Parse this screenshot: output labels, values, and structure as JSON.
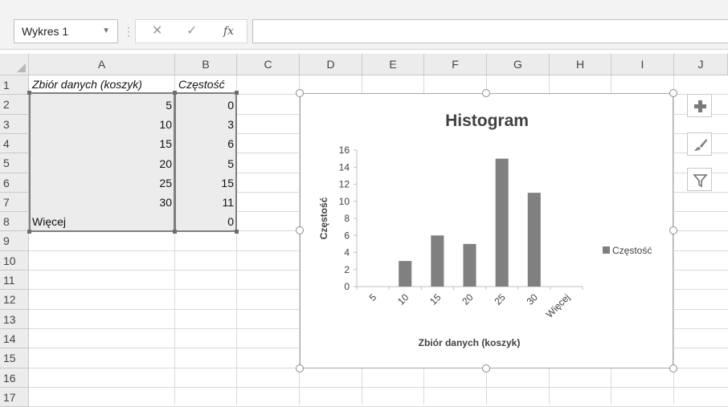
{
  "formula_bar": {
    "name_box": "Wykres 1",
    "dropdown_glyph": "▼",
    "separator_glyph": "⋮",
    "cancel_glyph": "✕",
    "confirm_glyph": "✓",
    "function_glyph": "fx",
    "formula_value": ""
  },
  "grid": {
    "columns": [
      "A",
      "B",
      "C",
      "D",
      "E",
      "F",
      "G",
      "H",
      "I",
      "J"
    ],
    "rows": [
      "1",
      "2",
      "3",
      "4",
      "5",
      "6",
      "7",
      "8",
      "9",
      "10",
      "11",
      "12",
      "13",
      "14",
      "15",
      "16",
      "17"
    ],
    "header": {
      "a": "Zbiór danych (koszyk)",
      "b": "Częstość"
    },
    "data_rows": [
      {
        "a": "5",
        "b": "0"
      },
      {
        "a": "10",
        "b": "3"
      },
      {
        "a": "15",
        "b": "6"
      },
      {
        "a": "20",
        "b": "5"
      },
      {
        "a": "25",
        "b": "15"
      },
      {
        "a": "30",
        "b": "11"
      },
      {
        "a": "Więcej",
        "b": "0"
      }
    ]
  },
  "chart_data": {
    "type": "bar",
    "title": "Histogram",
    "xlabel": "Zbiór danych (koszyk)",
    "ylabel": "Częstość",
    "categories": [
      "5",
      "10",
      "15",
      "20",
      "25",
      "30",
      "Więcej"
    ],
    "series": [
      {
        "name": "Częstość",
        "values": [
          0,
          3,
          6,
          5,
          15,
          11,
          0
        ],
        "color": "#808080"
      }
    ],
    "ylim": [
      0,
      16
    ],
    "yticks": [
      "0",
      "2",
      "4",
      "6",
      "8",
      "10",
      "12",
      "14",
      "16"
    ],
    "grid": false,
    "legend": "right"
  },
  "side_buttons": [
    {
      "name": "chart-elements-button",
      "icon": "plus-icon"
    },
    {
      "name": "chart-styles-button",
      "icon": "brush-icon"
    },
    {
      "name": "chart-filters-button",
      "icon": "filter-icon"
    }
  ]
}
